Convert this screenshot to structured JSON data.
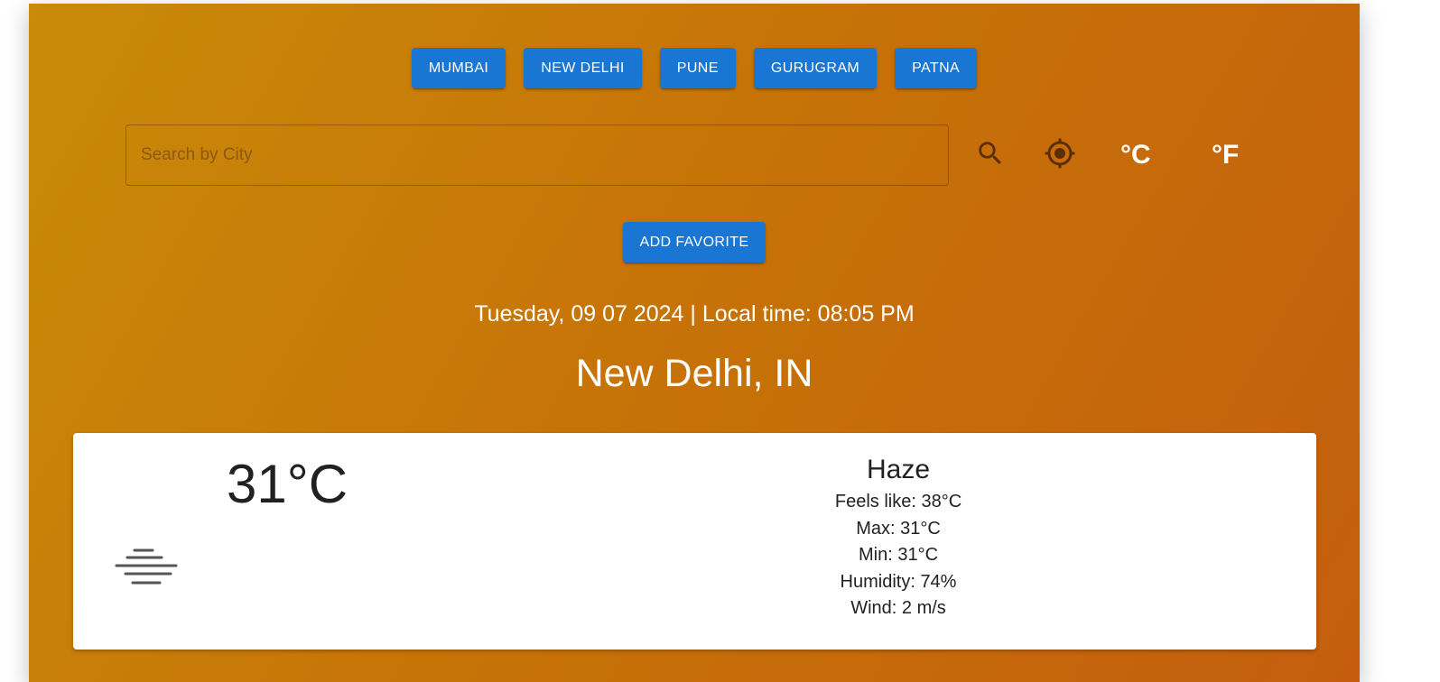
{
  "favorites": [
    "MUMBAI",
    "NEW DELHI",
    "PUNE",
    "GURUGRAM",
    "PATNA"
  ],
  "search": {
    "placeholder": "Search by City",
    "value": ""
  },
  "icons": {
    "search": "search-icon",
    "location": "my-location-icon",
    "condition": "haze-icon"
  },
  "units": {
    "celsius": "°C",
    "fahrenheit": "°F"
  },
  "add_favorite_label": "ADD FAVORITE",
  "datetime": "Tuesday, 09 07 2024 | Local time: 08:05 PM",
  "location": "New Delhi, IN",
  "weather": {
    "temperature": "31°C",
    "condition": "Haze",
    "feels_like": "Feels like: 38°C",
    "max": "Max: 31°C",
    "min": "Min: 31°C",
    "humidity": "Humidity: 74%",
    "wind": "Wind: 2 m/s"
  },
  "colors": {
    "accent": "#1976d2",
    "background_start": "#c98b09",
    "background_end": "#c45e0e",
    "icon": "#5a2f08"
  }
}
